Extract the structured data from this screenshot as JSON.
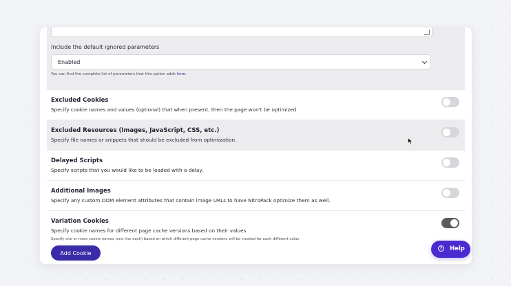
{
  "ignored_params": {
    "label": "Include the default ignored parameters",
    "select_value": "Enabled",
    "hint_text": "You can find the complete list of parameters that this option adds ",
    "hint_link": "here",
    "hint_end": "."
  },
  "settings": [
    {
      "title": "Excluded Cookies",
      "description": "Specify cookie names and values (optional) that when present, then the page won't be optimized",
      "enabled": false
    },
    {
      "title": "Excluded Resources (Images, JavaScript, CSS, etc.)",
      "description": "Specify file names or snippets that should be excluded from optimization.",
      "enabled": false
    },
    {
      "title": "Delayed Scripts",
      "description": "Specify scripts that you would like to be loaded with a delay.",
      "enabled": false
    },
    {
      "title": "Additional Images",
      "description": "Specify any custom DOM element attributes that contain image URLs to have NitroPack optimize them as well.",
      "enabled": false
    },
    {
      "title": "Variation Cookies",
      "description": "Specify cookie names for different page cache versions based on their values",
      "enabled": true
    }
  ],
  "variation_note": "Specify one or more cookie names (one line each) based on which different page cache versions will be created for each different value",
  "add_cookie_label": "Add Cookie",
  "help_label": "Help",
  "help_icon_glyph": "?",
  "colors": {
    "primary": "#3a2ba8",
    "help": "#4b2bd1",
    "toggle_off": "#d6d7db",
    "toggle_on": "#5b5c62"
  }
}
